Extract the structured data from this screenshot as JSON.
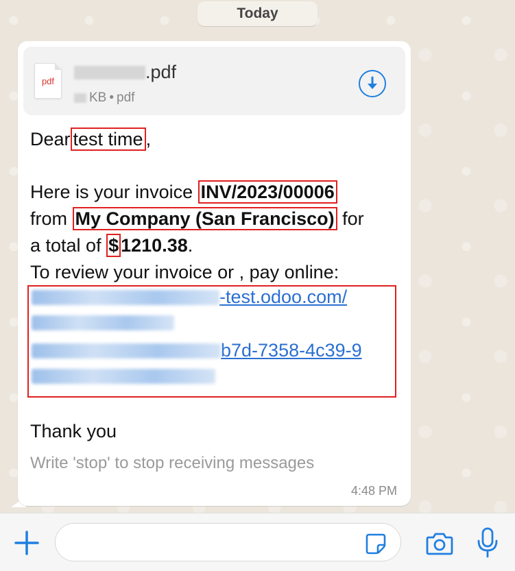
{
  "date_chip": "Today",
  "file": {
    "icon_label": "pdf",
    "name_suffix": ".pdf",
    "size_unit": "KB",
    "separator": "•",
    "type": "pdf",
    "download_icon": "download-icon"
  },
  "message": {
    "greeting_prefix": "Dear",
    "customer_name": "test time",
    "greeting_suffix": ",",
    "invoice_intro": "Here is your invoice",
    "invoice_number": "INV/2023/00006",
    "from_word": "from",
    "company": "My Company (San Francisco)",
    "for_word": "for",
    "total_prefix": "a total of",
    "currency": "$",
    "amount": "1210.38",
    "total_suffix": ".",
    "review_line": "To review your invoice or , pay online:",
    "link_part_1": "-test.odoo.com/",
    "link_part_3": "b7d-7358-4c39-9",
    "thanks": "Thank you",
    "footer": "Write 'stop' to stop receiving messages",
    "time": "4:48 PM"
  },
  "composer": {
    "placeholder": "",
    "plus_icon": "plus-icon",
    "sticker_icon": "sticker-icon",
    "camera_icon": "camera-icon",
    "mic_icon": "microphone-icon"
  },
  "colors": {
    "accent": "#1f7fe0",
    "highlight_border": "#e0201f",
    "link": "#2a6fd1",
    "background": "#ece5dd"
  }
}
